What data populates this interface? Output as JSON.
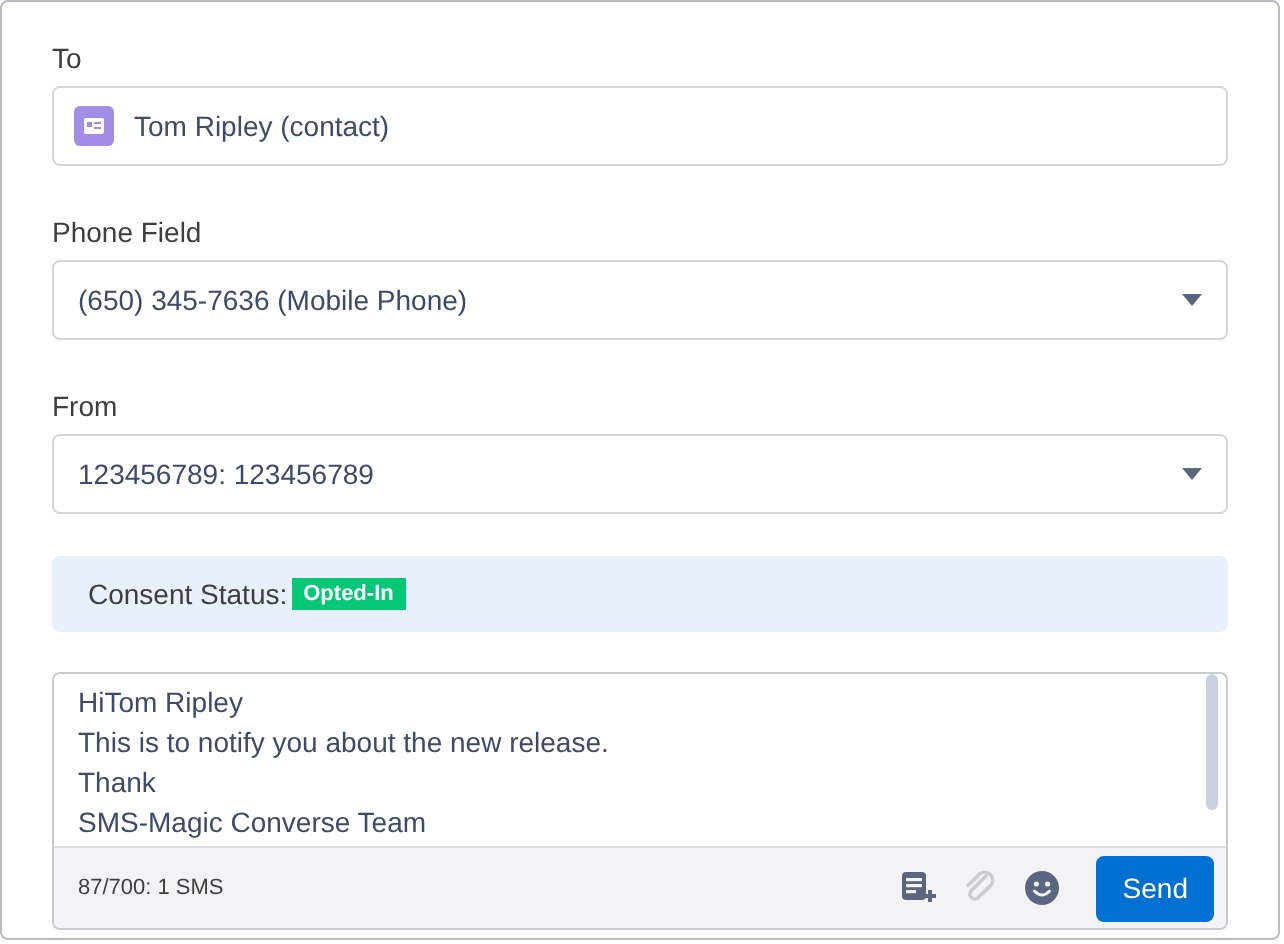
{
  "to": {
    "label": "To",
    "value": "Tom Ripley (contact)"
  },
  "fields": [
    {
      "label": "Phone Field",
      "value": "(650) 345-7636 (Mobile Phone)"
    },
    {
      "label": "From",
      "value": "123456789: 123456789"
    }
  ],
  "consent": {
    "label": "Consent Status:",
    "badge": "Opted-In",
    "color": "#04c876"
  },
  "message": {
    "lines": [
      "HiTom Ripley",
      "This is to notify you about the new release.",
      "Thank",
      "SMS-Magic Converse Team"
    ],
    "counter": "87/700: 1 SMS",
    "tools": [
      {
        "kind": "template",
        "disabled": false
      },
      {
        "kind": "attach",
        "disabled": true
      },
      {
        "kind": "emoji",
        "disabled": false
      }
    ],
    "send": "Send"
  }
}
